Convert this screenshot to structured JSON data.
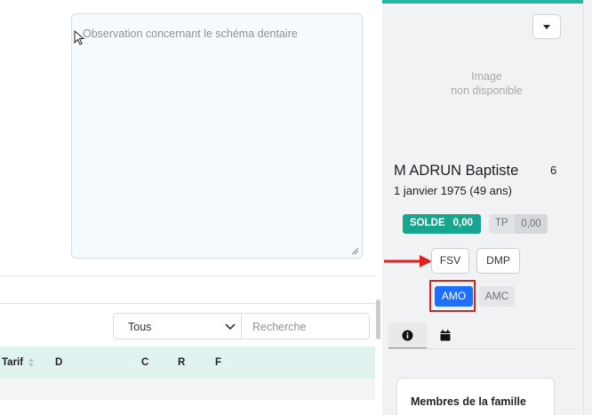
{
  "observation": {
    "placeholder": "Observation concernant le schéma dentaire"
  },
  "filters": {
    "select_value": "Tous",
    "search_placeholder": "Recherche"
  },
  "table": {
    "headers": [
      "Tarif",
      "D",
      "C",
      "R",
      "F"
    ]
  },
  "patient": {
    "image_placeholder_line1": "Image",
    "image_placeholder_line2": "non disponible",
    "name": "M ADRUN Baptiste",
    "number": "6",
    "dob": "1 janvier 1975 (49 ans)"
  },
  "balance": {
    "solde_label": "SOLDE",
    "solde_value": "0,00",
    "tp_label": "TP",
    "tp_value": "0,00"
  },
  "actions": {
    "fsv": "FSV",
    "dmp": "DMP",
    "amo": "AMO",
    "amc": "AMC"
  },
  "tabs": [
    {
      "icon": "info-icon"
    },
    {
      "icon": "calendar-icon"
    }
  ],
  "family": {
    "title": "Membres de la famille"
  },
  "colors": {
    "accent": "#20b8a1",
    "solde": "#17a58f",
    "amo": "#1f6fff",
    "highlight": "#e02020"
  }
}
